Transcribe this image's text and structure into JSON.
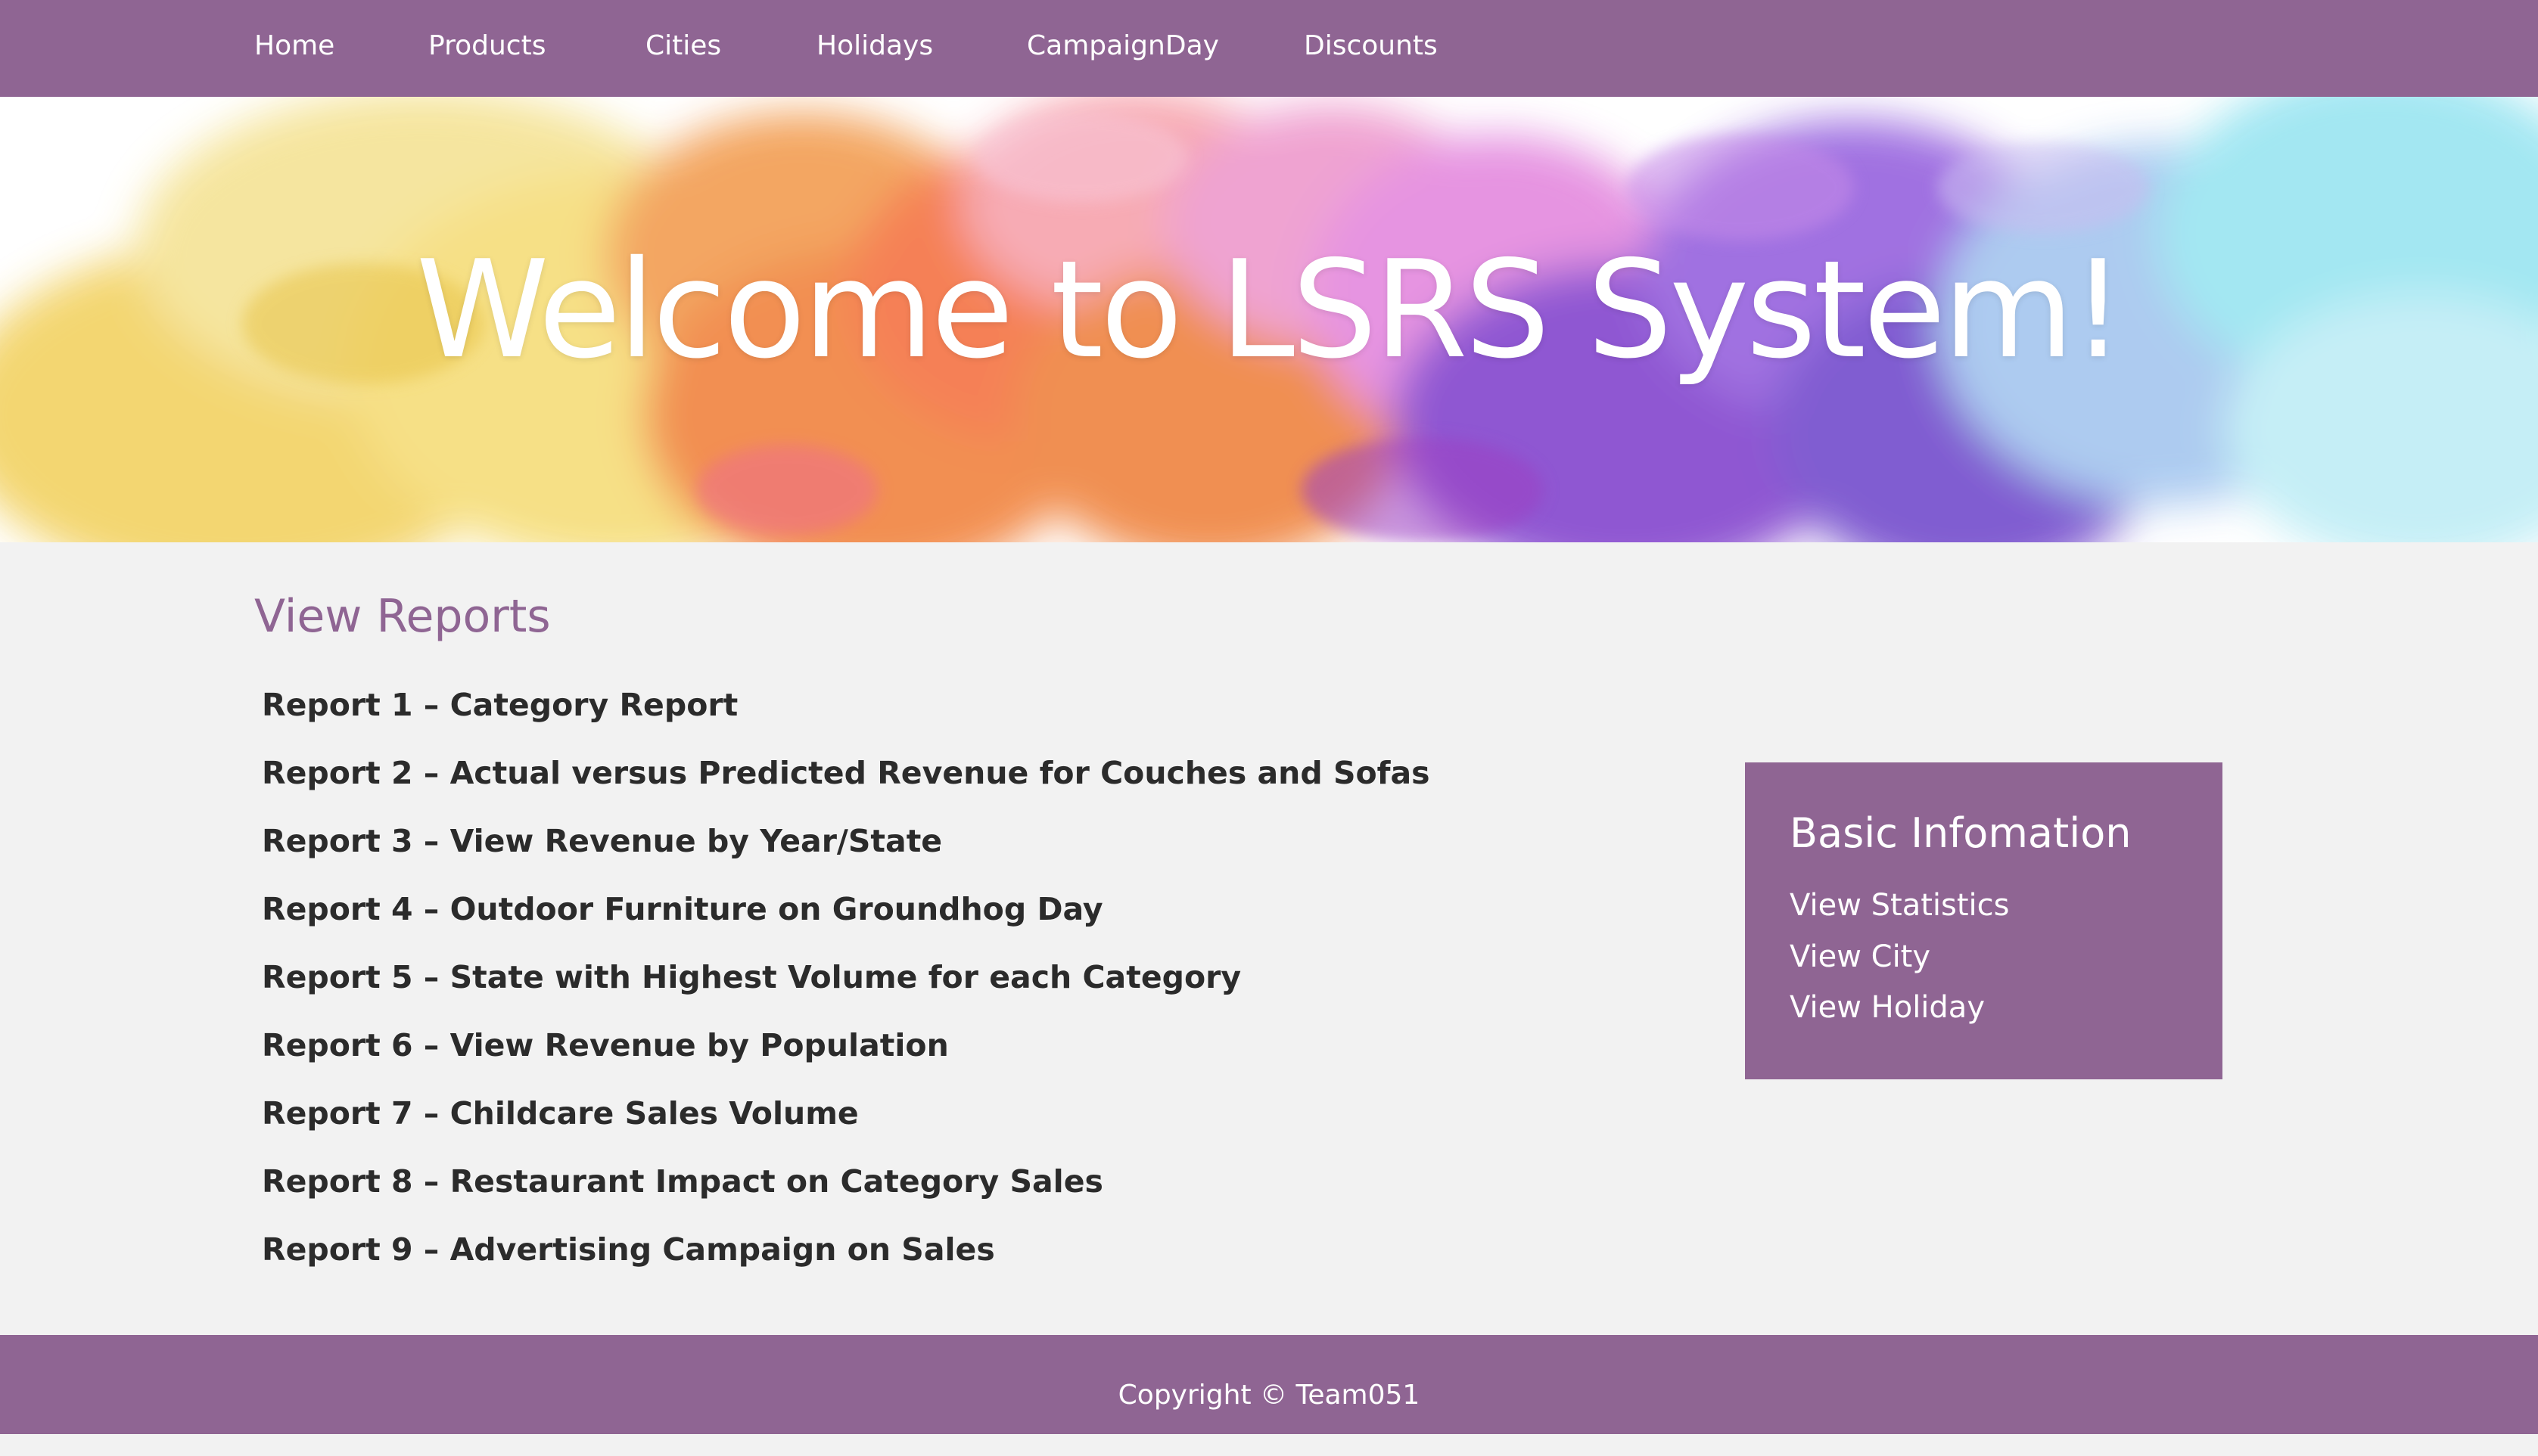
{
  "nav": {
    "items": [
      {
        "label": "Home"
      },
      {
        "label": "Products"
      },
      {
        "label": "Cities"
      },
      {
        "label": "Holidays"
      },
      {
        "label": "CampaignDay"
      },
      {
        "label": "Discounts"
      }
    ]
  },
  "hero": {
    "title": "Welcome to LSRS System!"
  },
  "reports": {
    "heading": "View Reports",
    "items": [
      {
        "label": "Report 1 – Category Report"
      },
      {
        "label": "Report 2 – Actual versus Predicted Revenue for Couches and Sofas"
      },
      {
        "label": "Report 3 – View Revenue by Year/State"
      },
      {
        "label": "Report 4 – Outdoor Furniture on Groundhog Day"
      },
      {
        "label": "Report 5 – State with Highest Volume for each Category"
      },
      {
        "label": "Report 6 – View Revenue by Population"
      },
      {
        "label": "Report 7 – Childcare Sales Volume"
      },
      {
        "label": "Report 8 – Restaurant Impact on Category Sales"
      },
      {
        "label": "Report 9 – Advertising Campaign on Sales"
      }
    ]
  },
  "info_box": {
    "title": "Basic Infomation",
    "links": [
      {
        "label": "View Statistics"
      },
      {
        "label": "View City"
      },
      {
        "label": "View Holiday"
      }
    ]
  },
  "footer": {
    "text": "Copyright © Team051"
  },
  "colors": {
    "brand": "#8f6593",
    "background": "#f2f2f2",
    "text": "#2b2b2b"
  }
}
